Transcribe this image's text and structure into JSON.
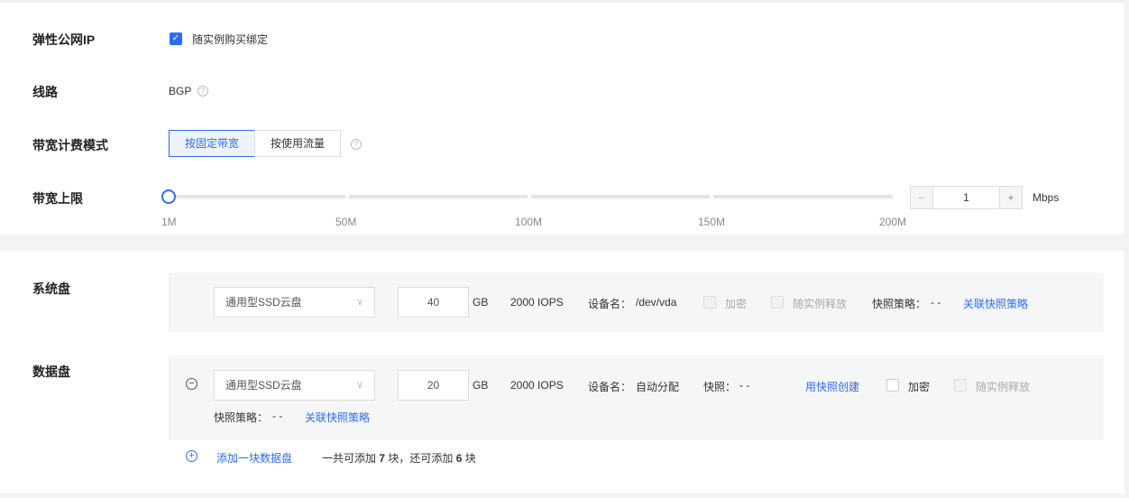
{
  "eip": {
    "label": "弹性公网IP",
    "checkbox_label": "随实例购买绑定",
    "checked": true
  },
  "line": {
    "label": "线路",
    "value": "BGP"
  },
  "billing": {
    "label": "带宽计费模式",
    "options": [
      "按固定带宽",
      "按使用流量"
    ],
    "selected": "按固定带宽"
  },
  "bandwidth": {
    "label": "带宽上限",
    "ticks": [
      "1M",
      "50M",
      "100M",
      "150M",
      "200M"
    ],
    "value": "1",
    "unit": "Mbps",
    "minus": "−",
    "plus": "+",
    "slider_fraction": 0
  },
  "system_disk": {
    "label": "系统盘",
    "type": "通用型SSD云盘",
    "size": "40",
    "size_unit": "GB",
    "iops": "2000 IOPS",
    "device_label": "设备名：",
    "device": "/dev/vda",
    "encrypt": "加密",
    "release": "随实例释放",
    "snapshot_policy_label": "快照策略：",
    "snapshot_policy": "- -",
    "link_policy": "关联快照策略"
  },
  "data_disk": {
    "label": "数据盘",
    "type": "通用型SSD云盘",
    "size": "20",
    "size_unit": "GB",
    "iops": "2000 IOPS",
    "device_label": "设备名：",
    "device": "自动分配",
    "snapshot_label": "快照：",
    "snapshot": "- -",
    "create_from_snapshot": "用快照创建",
    "encrypt": "加密",
    "release": "随实例释放",
    "snapshot_policy_label": "快照策略：",
    "snapshot_policy": "- -",
    "link_policy": "关联快照策略"
  },
  "add_disk": {
    "label": "添加一块数据盘",
    "info_prefix": "一共可添加",
    "total": "7",
    "info_mid": "块，还可添加",
    "remaining": "6",
    "info_suffix": "块"
  }
}
